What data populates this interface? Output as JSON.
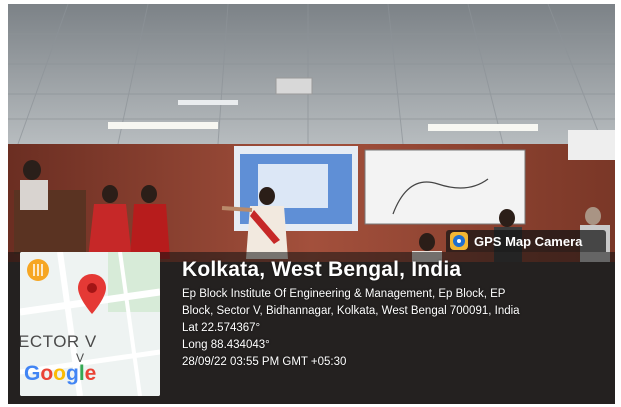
{
  "badge": {
    "label": "GPS Map Camera",
    "icon": "gps-map-camera-icon"
  },
  "location": {
    "title": "Kolkata, West Bengal, India",
    "address_line1": "Ep Block Institute Of Engineering & Management, Ep Block, EP",
    "address_line2": "Block, Sector V, Bidhannagar, Kolkata, West Bengal 700091, India",
    "lat": "Lat 22.574367°",
    "long": "Long 88.434043°",
    "datetime": "28/09/22 03:55 PM GMT +05:30"
  },
  "map": {
    "area_label": "ECTOR V",
    "sub_label": "V",
    "brand": [
      "G",
      "o",
      "o",
      "g",
      "l",
      "e"
    ],
    "pin_color": "#e53935"
  },
  "colors": {
    "wall": "#9a4a3a",
    "ceiling": "#a7aeb3",
    "saree": "#c62828"
  }
}
